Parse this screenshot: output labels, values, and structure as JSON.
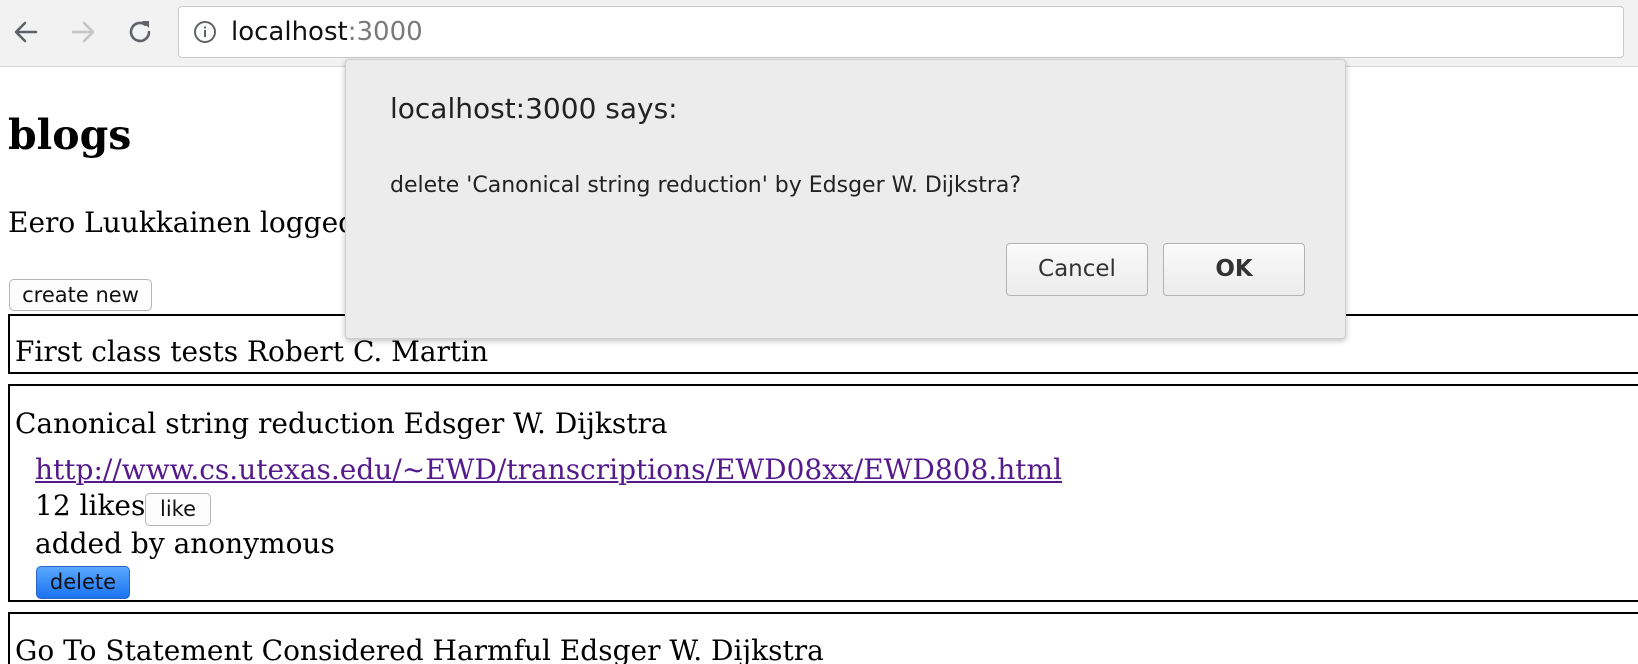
{
  "browser": {
    "url_host": "localhost",
    "url_port": ":3000"
  },
  "page": {
    "title": "blogs",
    "login_status": "Eero Luukkainen logged in",
    "create_new_label": "create new"
  },
  "blogs": [
    {
      "title": "First class tests Robert C. Martin"
    },
    {
      "title": "Canonical string reduction Edsger W. Dijkstra",
      "url": "http://www.cs.utexas.edu/~EWD/transcriptions/EWD08xx/EWD808.html",
      "likes": "12 likes",
      "like_label": "like",
      "added_by": "added by anonymous",
      "delete_label": "delete"
    },
    {
      "title": "Go To Statement Considered Harmful Edsger W. Dijkstra"
    }
  ],
  "dialog": {
    "title": "localhost:3000 says:",
    "message": "delete 'Canonical string reduction' by Edsger W. Dijkstra?",
    "cancel_label": "Cancel",
    "ok_label": "OK"
  }
}
